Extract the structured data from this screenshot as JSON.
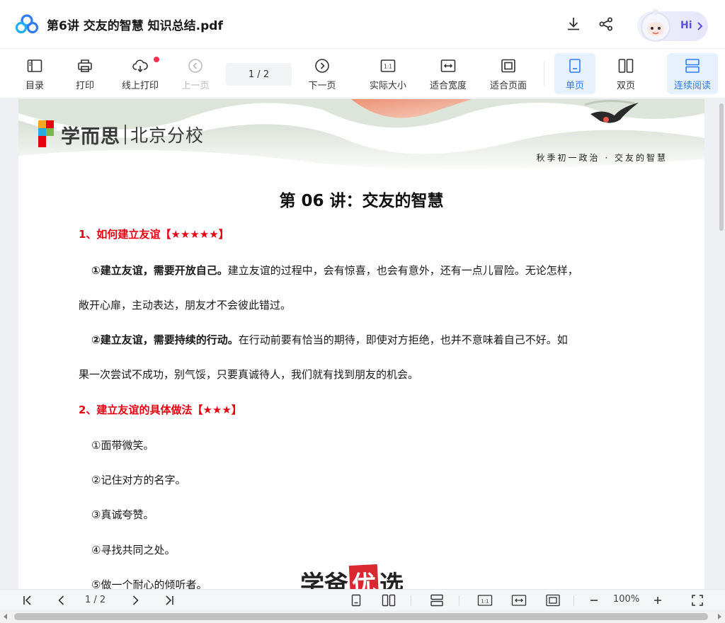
{
  "titlebar": {
    "document_title": "第6讲 交友的智慧 知识总结.pdf",
    "download_icon": "download-icon",
    "share_icon": "share-icon",
    "assistant_label": "Hi"
  },
  "toolbar": {
    "items": [
      {
        "label": "目录",
        "icon": "toc-icon"
      },
      {
        "label": "打印",
        "icon": "printer-icon"
      },
      {
        "label": "线上打印",
        "icon": "cloud-print-icon"
      },
      {
        "label": "上一页",
        "icon": "prev-page-icon"
      },
      {
        "label": "下一页",
        "icon": "next-page-icon"
      },
      {
        "label": "实际大小",
        "icon": "actual-size-icon"
      },
      {
        "label": "适合宽度",
        "icon": "fit-width-icon"
      },
      {
        "label": "适合页面",
        "icon": "fit-page-icon"
      },
      {
        "label": "单页",
        "icon": "single-page-icon"
      },
      {
        "label": "双页",
        "icon": "double-page-icon"
      },
      {
        "label": "连续阅读",
        "icon": "continuous-icon"
      }
    ],
    "page_indicator": "1  / 2",
    "accent": "#2f7cf6"
  },
  "document": {
    "brand": "学而思",
    "branch": "北京分校",
    "course_line": "秋季初一政治 · 交友的智慧",
    "lesson_title": "第 06 讲：交友的智慧",
    "section1_heading": "1、如何建立友谊【★★★★★】",
    "p1_bold": "①建立友谊，需要开放自己。",
    "p1_text": "建立友谊的过程中，会有惊喜，也会有意外，还有一点儿冒险。无论怎样，",
    "p1_cont": "敞开心扉，主动表达，朋友才不会彼此错过。",
    "p2_bold": "②建立友谊，需要持续的行动。",
    "p2_text": "在行动前要有恰当的期待，即使对方拒绝，也并不意味着自己不好。如",
    "p2_cont": "果一次尝试不成功，别气馁，只要真诚待人，我们就有找到朋友的机会。",
    "section2_heading": "2、建立友谊的具体做法【★★★】",
    "list": [
      "①面带微笑。",
      "②记住对方的名字。",
      "③真诚夸赞。",
      "④寻找共同之处。",
      "⑤做一个耐心的倾听者。"
    ],
    "heading_color": "#e60012"
  },
  "bottombar": {
    "page_indicator": "1 / 2",
    "zoom": "100%"
  },
  "watermark": {
    "part1": "学爸",
    "part2": "优",
    "part3": "选"
  }
}
